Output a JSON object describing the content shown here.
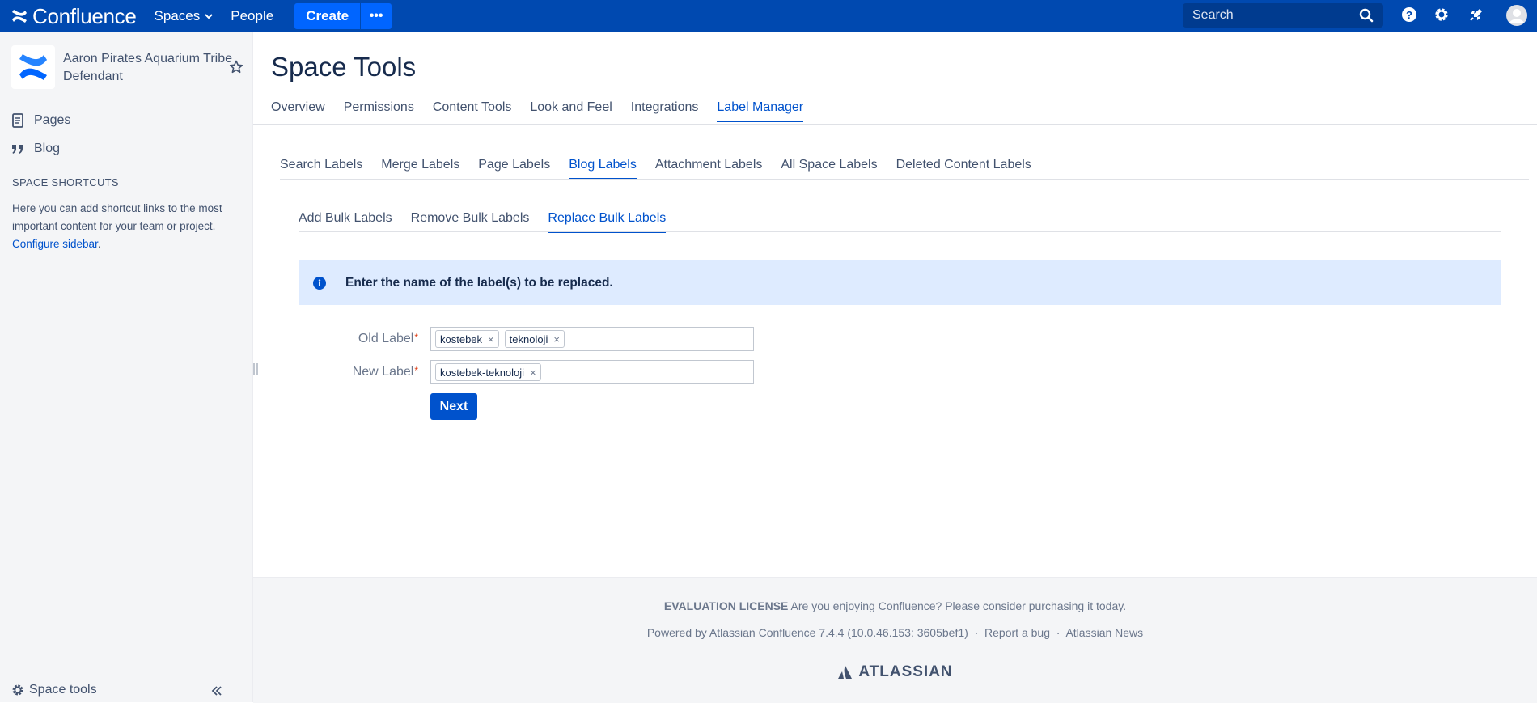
{
  "colors": {
    "nav_bg": "#0049b0",
    "accent": "#0052cc",
    "banner_bg": "#deebff",
    "required": "#de350b"
  },
  "topnav": {
    "app_name": "Confluence",
    "spaces_label": "Spaces",
    "people_label": "People",
    "create_label": "Create",
    "more_label": "•••",
    "search_placeholder": "Search",
    "icons": [
      "help-icon",
      "settings-icon",
      "notifications-icon",
      "avatar"
    ]
  },
  "sidebar": {
    "space_name": "Aaron Pirates Aquarium Tribe Defendant",
    "items": [
      {
        "label": "Pages",
        "icon": "pages-icon"
      },
      {
        "label": "Blog",
        "icon": "blog-icon"
      }
    ],
    "shortcuts_title": "SPACE SHORTCUTS",
    "shortcuts_desc": "Here you can add shortcut links to the most important content for your team or project.",
    "configure_link": "Configure sidebar",
    "configure_suffix": ".",
    "space_tools_label": "Space tools"
  },
  "main": {
    "title": "Space Tools",
    "tabs": [
      "Overview",
      "Permissions",
      "Content Tools",
      "Look and Feel",
      "Integrations",
      "Label Manager"
    ],
    "active_tab": "Label Manager",
    "subtabs": [
      "Search Labels",
      "Merge Labels",
      "Page Labels",
      "Blog Labels",
      "Attachment Labels",
      "All Space Labels",
      "Deleted Content Labels"
    ],
    "active_subtab": "Blog Labels",
    "bulk_tabs": [
      "Add Bulk Labels",
      "Remove Bulk Labels",
      "Replace Bulk Labels"
    ],
    "active_bulk_tab": "Replace Bulk Labels",
    "info_message": "Enter the name of the label(s) to be replaced.",
    "form": {
      "old_label": "Old Label",
      "old_values": [
        "kostebek",
        "teknoloji"
      ],
      "new_label": "New Label",
      "new_values": [
        "kostebek-teknoloji"
      ],
      "required_mark": "*",
      "chip_remove": "×",
      "next_label": "Next"
    }
  },
  "footer": {
    "license_bold": "EVALUATION LICENSE",
    "license_text": "Are you enjoying Confluence? Please consider purchasing it today.",
    "powered_by": "Powered by Atlassian Confluence 7.4.4 (10.0.46.153: 3605bef1)",
    "separator": "·",
    "report_bug": "Report a bug",
    "news": "Atlassian News",
    "brand": "ATLASSIAN"
  }
}
